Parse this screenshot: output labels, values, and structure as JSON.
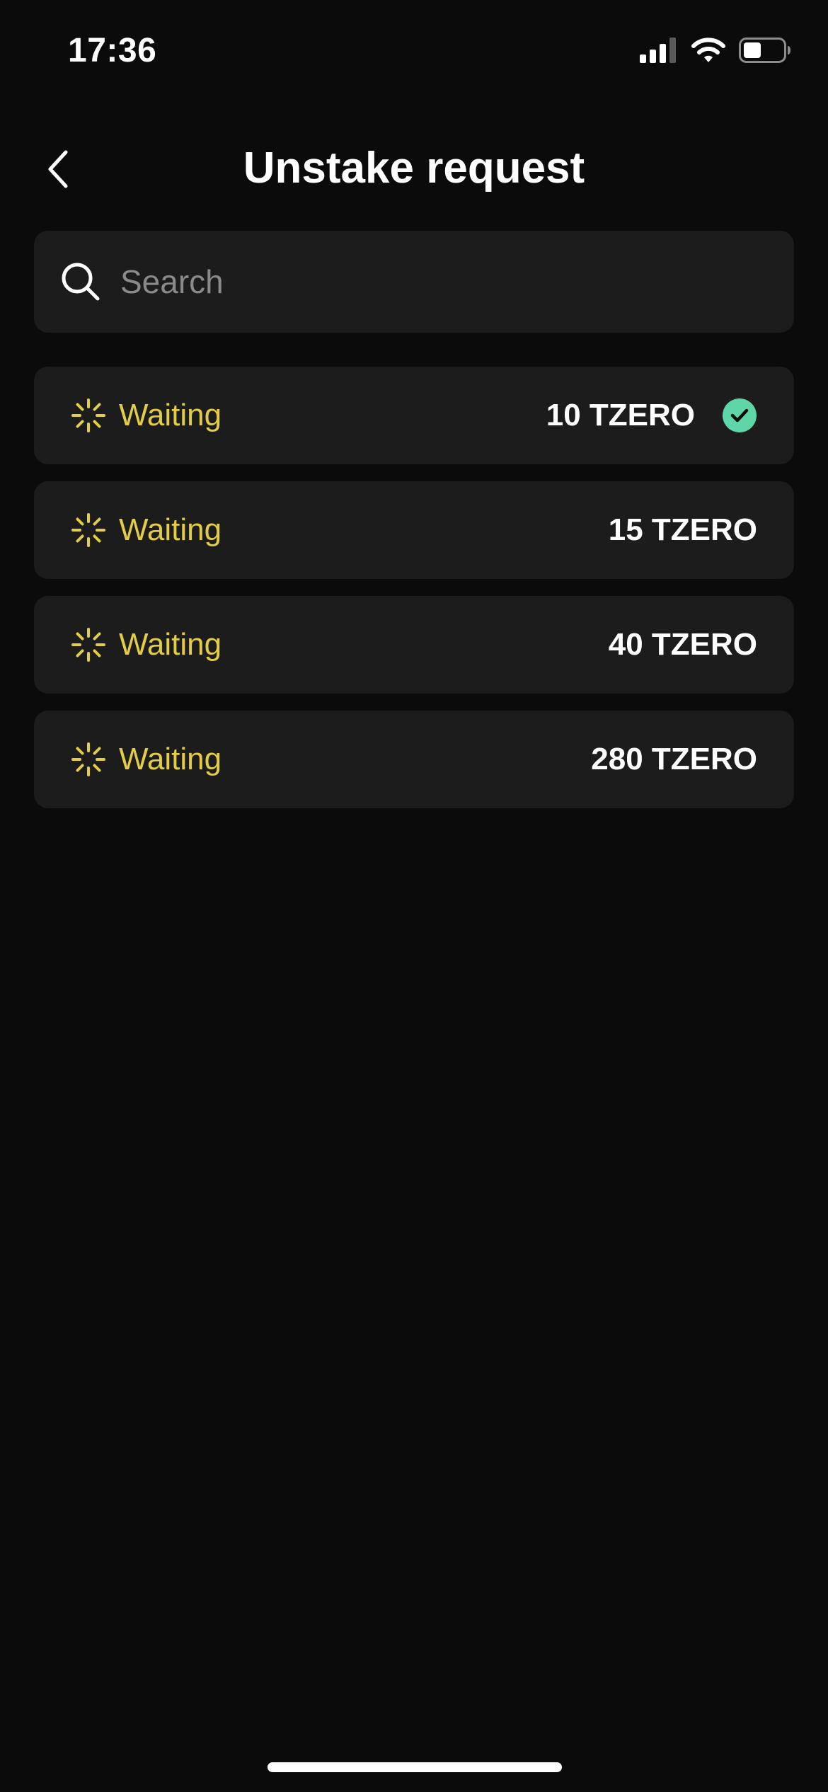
{
  "status_bar": {
    "time": "17:36"
  },
  "header": {
    "title": "Unstake request",
    "back_icon": "chevron-left-icon"
  },
  "search": {
    "placeholder": "Search",
    "value": "",
    "icon": "search-icon"
  },
  "requests": [
    {
      "status": "Waiting",
      "amount": "10 TZERO",
      "selected": true
    },
    {
      "status": "Waiting",
      "amount": "15 TZERO",
      "selected": false
    },
    {
      "status": "Waiting",
      "amount": "40 TZERO",
      "selected": false
    },
    {
      "status": "Waiting",
      "amount": "280 TZERO",
      "selected": false
    }
  ],
  "colors": {
    "background": "#0b0b0b",
    "card": "#1c1c1c",
    "waiting": "#e2cd45",
    "check": "#5fd6a8"
  }
}
